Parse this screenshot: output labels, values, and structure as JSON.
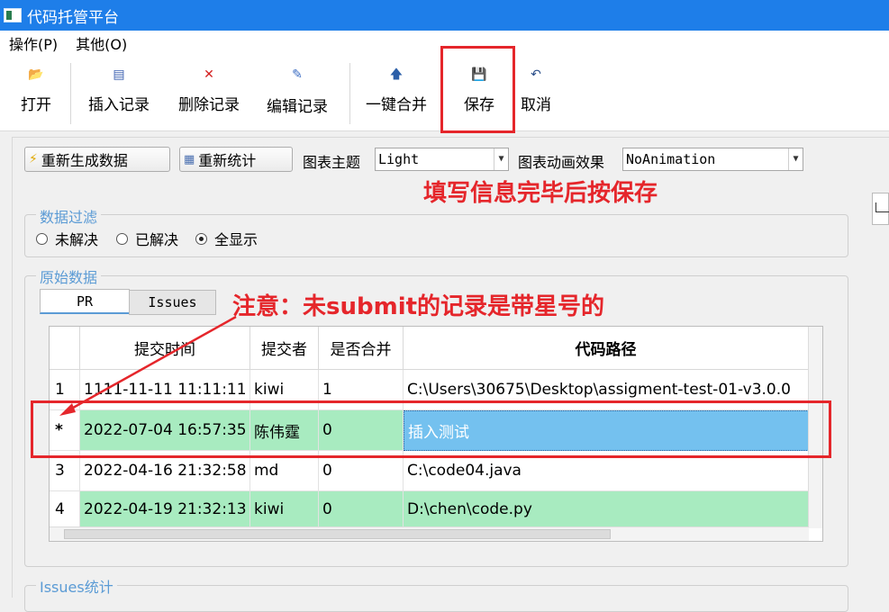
{
  "window": {
    "title": "代码托管平台"
  },
  "menu": [
    "操作(P)",
    "其他(O)"
  ],
  "toolbar": {
    "open": "打开",
    "insert": "插入记录",
    "delete": "删除记录",
    "edit": "编辑记录",
    "merge": "一键合并",
    "save": "保存",
    "cancel": "取消"
  },
  "controls": {
    "regen_button": "重新生成数据",
    "restat_button": "重新统计",
    "theme_label": "图表主题",
    "theme_value": "Light",
    "anim_label": "图表动画效果",
    "anim_value": "NoAnimation"
  },
  "filter": {
    "title": "数据过滤",
    "options": [
      "未解决",
      "已解决",
      "全显示"
    ],
    "selected": "全显示"
  },
  "raw": {
    "title": "原始数据",
    "tabs": [
      "PR",
      "Issues"
    ],
    "active_tab": "PR",
    "columns": [
      "提交时间",
      "提交者",
      "是否合并",
      "代码路径"
    ],
    "rows": [
      {
        "head": "1",
        "time": "1111-11-11 11:11:11",
        "user": "kiwi",
        "merged": "1",
        "path": "C:\\Users\\30675\\Desktop\\assigment-test-01-v3.0.0"
      },
      {
        "head": "*",
        "time": "2022-07-04 16:57:35",
        "user": "陈伟霆",
        "merged": "0",
        "path": "插入测试"
      },
      {
        "head": "3",
        "time": "2022-04-16 21:32:58",
        "user": "md",
        "merged": "0",
        "path": "C:\\code04.java"
      },
      {
        "head": "4",
        "time": "2022-04-19 21:32:13",
        "user": "kiwi",
        "merged": "0",
        "path": "D:\\chen\\code.py"
      }
    ]
  },
  "issues_stats": {
    "title": "Issues统计"
  },
  "annotations": {
    "save_hint": "填写信息完毕后按保存",
    "star_hint": "注意：未submit的记录是带星号的"
  },
  "colors": {
    "titlebar": "#1e7ee9",
    "row_green": "#a8ebc0",
    "cell_selected": "#74c1ef",
    "annotation_red": "#e5262b"
  }
}
